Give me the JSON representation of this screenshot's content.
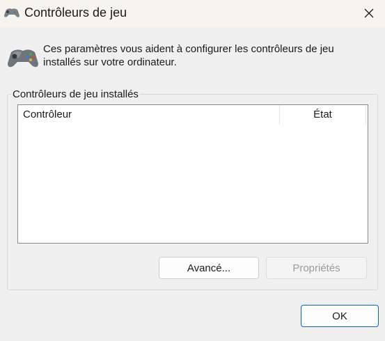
{
  "window": {
    "title": "Contrôleurs de jeu",
    "close_icon": "close-icon",
    "app_icon": "gamepad-icon"
  },
  "description": "Ces paramètres vous aident à configurer les contrôleurs de jeu installés sur votre ordinateur.",
  "group": {
    "label": "Contrôleurs de jeu installés",
    "columns": [
      "Contrôleur",
      "État"
    ],
    "rows": []
  },
  "buttons": {
    "advanced": "Avancé...",
    "properties": "Propriétés",
    "ok": "OK"
  },
  "colors": {
    "accent": "#0067c0",
    "disabled_text": "#9a9a9a"
  }
}
